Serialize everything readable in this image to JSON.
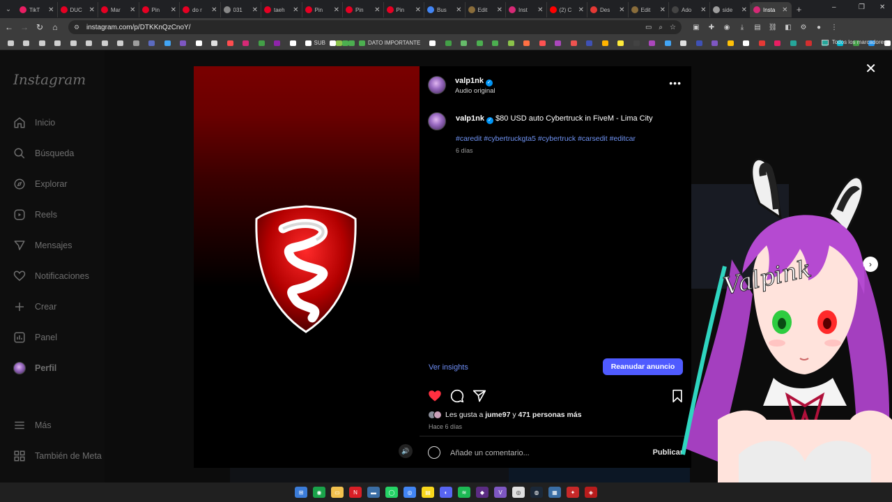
{
  "browser": {
    "tabs": [
      {
        "label": "TikT",
        "color": "#e91e63"
      },
      {
        "label": "DUC",
        "color": "#e60023"
      },
      {
        "label": "Mar",
        "color": "#e60023"
      },
      {
        "label": "Pin",
        "color": "#e60023"
      },
      {
        "label": "do r",
        "color": "#e60023"
      },
      {
        "label": "031",
        "color": "#888888"
      },
      {
        "label": "taeh",
        "color": "#e60023"
      },
      {
        "label": "Pin",
        "color": "#e60023"
      },
      {
        "label": "Pin",
        "color": "#e60023"
      },
      {
        "label": "Pin",
        "color": "#e60023"
      },
      {
        "label": "Bus",
        "color": "#4285f4"
      },
      {
        "label": "Edit",
        "color": "#8a6d3b"
      },
      {
        "label": "Inst",
        "color": "#d62976"
      },
      {
        "label": "(2) C",
        "color": "#ff0000"
      },
      {
        "label": "Des",
        "color": "#e53935"
      },
      {
        "label": "Edit",
        "color": "#8a6d3b"
      },
      {
        "label": "Ado",
        "color": "#444444"
      },
      {
        "label": "side",
        "color": "#9e9e9e"
      },
      {
        "label": "Insta",
        "color": "#d62976",
        "active": true
      }
    ],
    "new_tab": "+",
    "url": "instagram.com/p/DTKKnQzCnoY/",
    "all_bookmarks_label": "Todos los marcadores",
    "bookmarks_text_items": [
      "SUB",
      "DATO IMPORTANTE"
    ],
    "bookmark_colors": [
      "#cfcfcf",
      "#cfcfcf",
      "#cfcfcf",
      "#cfcfcf",
      "#cfcfcf",
      "#cfcfcf",
      "#cfcfcf",
      "#cfcfcf",
      "#9e9e9e",
      "#5c6bc0",
      "#42a5f5",
      "#7e57c2",
      "#ffffff",
      "#e0e0e0",
      "#ff4d4f",
      "#d62976",
      "#43a047",
      "#8e24aa",
      "#ffffff"
    ],
    "bookmark_colors_2": [
      "#ffffff",
      "#43a047",
      "#66bb6a",
      "#4caf50",
      "#4caf50",
      "#8bc34a",
      "#ff7043",
      "#ff5252",
      "#ab47bc",
      "#ef5350",
      "#3f51b5",
      "#ffb300",
      "#ffeb3b",
      "#424242",
      "#ab47bc",
      "#42a5f5",
      "#e0e0e0",
      "#3f51b5",
      "#7e57c2",
      "#ffc107",
      "#ffffff",
      "#e53935",
      "#e91e63",
      "#26a69a",
      "#d32f2f",
      "#26a69a",
      "#00bcd4",
      "#43a047",
      "#2196f3",
      "#ffffff",
      "#00bcd4"
    ]
  },
  "sidebar": {
    "logo": "Instagram",
    "items": [
      {
        "label": "Inicio",
        "icon": "home-icon"
      },
      {
        "label": "Búsqueda",
        "icon": "search-icon"
      },
      {
        "label": "Explorar",
        "icon": "compass-icon"
      },
      {
        "label": "Reels",
        "icon": "reels-icon"
      },
      {
        "label": "Mensajes",
        "icon": "messages-icon"
      },
      {
        "label": "Notificaciones",
        "icon": "heart-icon"
      },
      {
        "label": "Crear",
        "icon": "plus-icon"
      },
      {
        "label": "Panel",
        "icon": "chart-icon"
      },
      {
        "label": "Perfil",
        "icon": "avatar-icon"
      }
    ],
    "more": "Más",
    "meta": "También de Meta"
  },
  "post": {
    "username": "valp1nk",
    "audio": "Audio original",
    "caption": "$80 USD auto Cybertruck in FiveM - Lima City",
    "hashtags": "#caredit #cybertruckgta5 #cybertruck #carsedit #editcar",
    "caption_time": "6 días",
    "insights_label": "Ver insights",
    "resume_button": "Reanudar anuncio",
    "likes_prefix": "Les gusta a ",
    "likes_user": "jume97",
    "likes_mid": " y ",
    "likes_count": "471 personas más",
    "posted_ago": "Hace 6 días",
    "comment_placeholder": "Añade un comentario...",
    "publish": "Publicar"
  },
  "overlay": {
    "vtuber_text": "Valpink"
  },
  "colors": {
    "accent_blue": "#4f5bff",
    "link_blue": "#6f8ff7",
    "like_red": "#ff3040",
    "media_red": "#c40000"
  }
}
